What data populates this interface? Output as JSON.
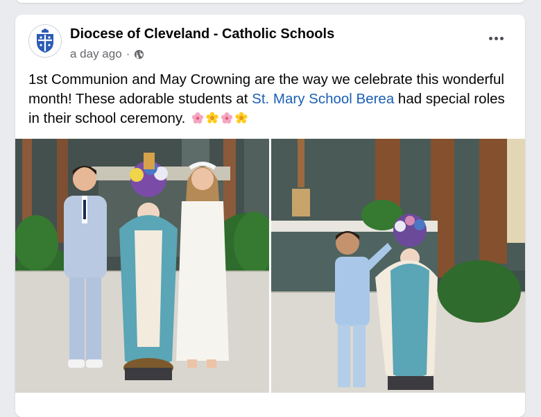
{
  "post": {
    "author": "Diocese of Cleveland - Catholic Schools",
    "time": "a day ago",
    "separator": "·",
    "text_before": "1st Communion and May Crowning are the way we celebrate this wonderful month! These adorable students at ",
    "link_text": "St. Mary School Berea",
    "text_after": " had special roles in their school ceremony.",
    "emojis": [
      "cherry-blossom",
      "sunflower",
      "cherry-blossom",
      "sunflower"
    ]
  },
  "icons": {
    "avatar": "diocese-crest",
    "audience": "globe-icon",
    "menu": "more-options-icon"
  },
  "colors": {
    "link": "#1a5fb4",
    "background": "#e9ebee",
    "card": "#ffffff",
    "secondary_text": "#65676b"
  }
}
